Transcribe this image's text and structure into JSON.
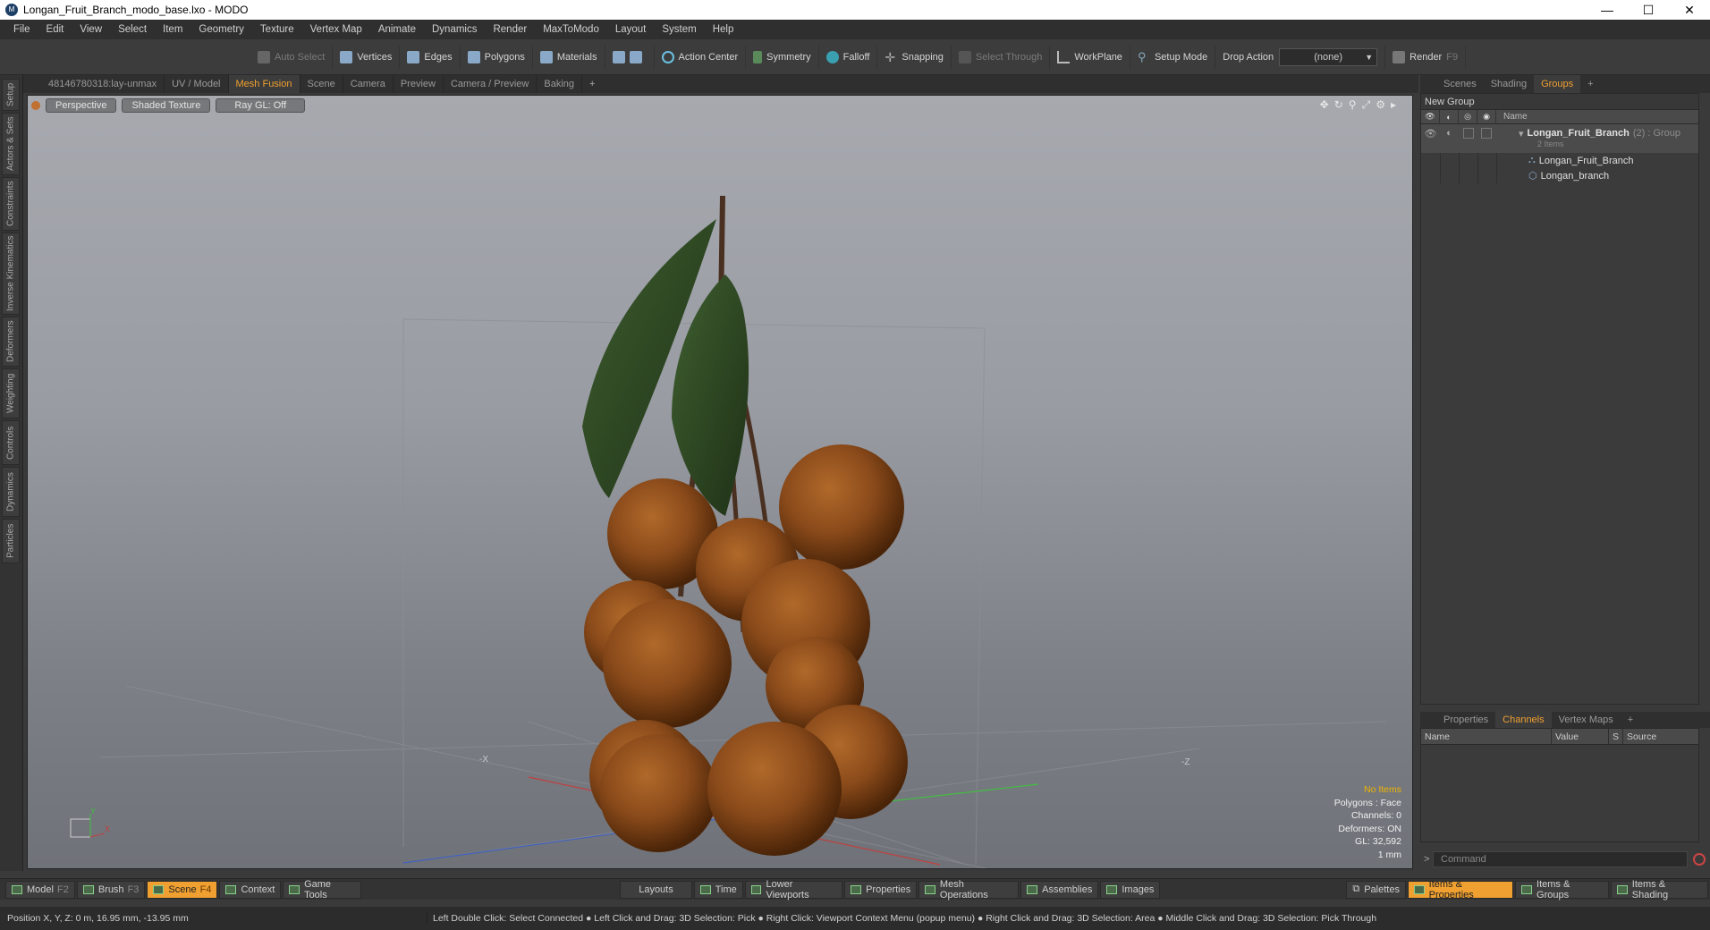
{
  "window": {
    "title": "Longan_Fruit_Branch_modo_base.lxo - MODO",
    "minimize": "—",
    "maximize": "☐",
    "close": "✕"
  },
  "menu": [
    "File",
    "Edit",
    "View",
    "Select",
    "Item",
    "Geometry",
    "Texture",
    "Vertex Map",
    "Animate",
    "Dynamics",
    "Render",
    "MaxToModo",
    "Layout",
    "System",
    "Help"
  ],
  "toolbar": {
    "auto_select": "Auto Select",
    "vertices": "Vertices",
    "edges": "Edges",
    "polygons": "Polygons",
    "materials": "Materials",
    "action_center": "Action Center",
    "symmetry": "Symmetry",
    "falloff": "Falloff",
    "snapping": "Snapping",
    "select_through": "Select Through",
    "workplane": "WorkPlane",
    "setup_mode": "Setup Mode",
    "drop_action_label": "Drop Action",
    "drop_action_value": "(none)",
    "render": "Render",
    "render_key": "F9"
  },
  "left_tabs": [
    "Setup",
    "Actors & Sets",
    "Constraints",
    "Inverse Kinematics",
    "Deformers",
    "Weighting",
    "Controls",
    "Dynamics",
    "Particles"
  ],
  "viewport_tabs": [
    "48146780318:lay-unmax",
    "UV / Model",
    "Mesh Fusion",
    "Scene",
    "Camera",
    "Preview",
    "Camera / Preview",
    "Baking",
    "+"
  ],
  "viewport_active_tab": "Mesh Fusion",
  "viewport": {
    "view_mode": "Perspective",
    "shading": "Shaded Texture",
    "raygl": "Ray GL: Off",
    "axis_labels": {
      "x_neg": "-X",
      "z_neg": "-Z",
      "y": "Y",
      "x": "X"
    },
    "info": {
      "selection": "No Items",
      "polygons": "Polygons : Face",
      "channels": "Channels: 0",
      "deformers": "Deformers: ON",
      "gl": "GL: 32,592",
      "scale": "1 mm"
    }
  },
  "right_tabs": [
    "Scenes",
    "Shading",
    "Groups",
    "+"
  ],
  "right_active_tab": "Groups",
  "groups": {
    "new_group": "New Group",
    "name_header": "Name",
    "group_name": "Longan_Fruit_Branch",
    "group_count": "(2) : Group",
    "group_sub": "2 Items",
    "items": [
      "Longan_Fruit_Branch",
      "Longan_branch"
    ]
  },
  "bottom_tabs": [
    "Properties",
    "Channels",
    "Vertex Maps",
    "+"
  ],
  "bottom_active_tab": "Channels",
  "channels": {
    "name": "Name",
    "value": "Value",
    "s": "S",
    "source": "Source"
  },
  "command_placeholder": "Command",
  "bottombar": {
    "left": [
      {
        "label": "Model",
        "key": "F2",
        "active": false
      },
      {
        "label": "Brush",
        "key": "F3",
        "active": false
      },
      {
        "label": "Scene",
        "key": "F4",
        "active": true
      },
      {
        "label": "Context",
        "key": "",
        "active": false
      },
      {
        "label": "Game Tools",
        "key": "",
        "active": false
      }
    ],
    "middle": [
      "Layouts",
      "Time",
      "Lower Viewports",
      "Properties",
      "Mesh Operations",
      "Assemblies",
      "Images"
    ],
    "right": [
      {
        "label": "Palettes",
        "active": false
      },
      {
        "label": "Items & Properties",
        "active": true
      },
      {
        "label": "Items & Groups",
        "active": false
      },
      {
        "label": "Items & Shading",
        "active": false
      }
    ]
  },
  "status": {
    "position": "Position X, Y, Z:   0 m, 16.95 mm, -13.95 mm",
    "hints": "Left Double Click: Select Connected ● Left Click and Drag: 3D Selection: Pick ● Right Click: Viewport Context Menu (popup menu) ● Right Click and Drag: 3D Selection: Area ● Middle Click and Drag: 3D Selection: Pick Through"
  },
  "colors": {
    "accent": "#f0a030",
    "fruit": "#8a4a1a",
    "leaf": "#2e4a24",
    "stem": "#4a3020"
  }
}
